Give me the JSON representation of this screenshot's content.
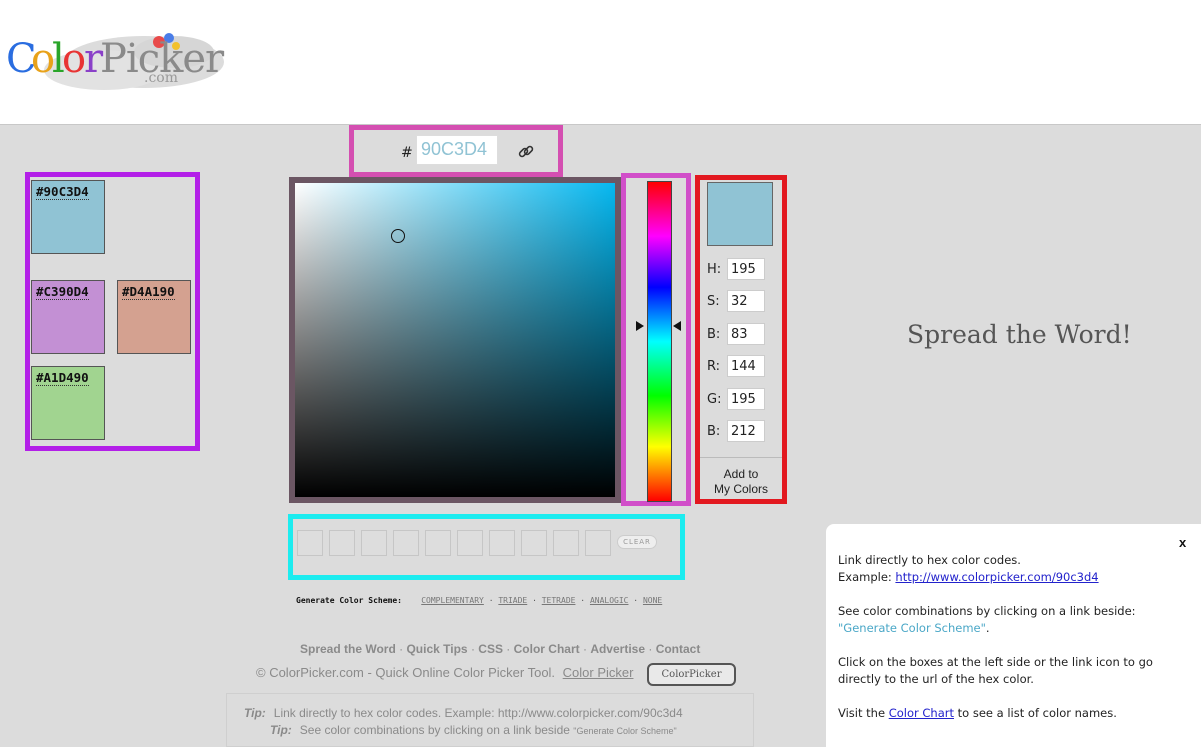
{
  "logo": {
    "text": "ColorPicker",
    "domain": ".com"
  },
  "palette": {
    "swatches": [
      {
        "hex": "#90C3D4",
        "color": "#90c3d4"
      },
      {
        "hex": "#C390D4",
        "color": "#c390d4"
      },
      {
        "hex": "#D4A190",
        "color": "#d4a190"
      },
      {
        "hex": "#A1D490",
        "color": "#a1d490"
      }
    ]
  },
  "hexbar": {
    "hash": "#",
    "value": "90C3D4"
  },
  "values": {
    "h_label": "H:",
    "h": "195",
    "s_label": "S:",
    "s": "32",
    "b_label": "B:",
    "b": "83",
    "r_label": "R:",
    "r": "144",
    "g_label": "G:",
    "g": "195",
    "b2_label": "B:",
    "b2": "212",
    "add_line1": "Add to",
    "add_line2": "My Colors",
    "preview_color": "#90c3d4"
  },
  "recent": {
    "clear_label": "CLEAR",
    "slot_count": 10
  },
  "scheme": {
    "label": "Generate Color Scheme:",
    "options": [
      "COMPLEMENTARY",
      "TRIADE",
      "TETRADE",
      "ANALOGIC",
      "NONE"
    ]
  },
  "footer": {
    "links": [
      "Spread the Word",
      "Quick Tips",
      "CSS",
      "Color Chart",
      "Advertise",
      "Contact"
    ],
    "copyright": "© ColorPicker.com - Quick Online Color Picker Tool.",
    "color_picker_link": "Color Picker",
    "badge": "ColorPicker"
  },
  "tips": [
    {
      "label": "Tip:",
      "text": "Link directly to hex color codes.   Example:  http://www.colorpicker.com/90c3d4"
    },
    {
      "label": "Tip:",
      "text": "See color combinations by clicking on a link beside",
      "small": "\"Generate Color Scheme\""
    }
  ],
  "spread": {
    "title": "Spread the Word!"
  },
  "popup": {
    "close": "x",
    "p1_line1": "Link directly to hex color codes.",
    "p1_prefix": "Example: ",
    "p1_link": "http://www.colorpicker.com/90c3d4",
    "p2_line1": "See color combinations by clicking on a link beside:",
    "p2_quote": "\"Generate Color Scheme\"",
    "p2_end": ".",
    "p3_line1": "Click on the boxes at the left side or the link icon to go",
    "p3_line2": "directly to the url of the hex color.",
    "p4_prefix": "Visit the ",
    "p4_link": "Color Chart",
    "p4_suffix": " to see a list of color names."
  },
  "colors": {
    "palette_border": "#b31fe8",
    "hexbar_border": "#d44fb1",
    "hue_border": "#d14fc9",
    "values_border": "#e2181f",
    "recent_border": "#1cecef",
    "sb_hue": "#06b8f0"
  },
  "icons": {
    "link": "link-chain-icon",
    "close": "close-icon"
  }
}
